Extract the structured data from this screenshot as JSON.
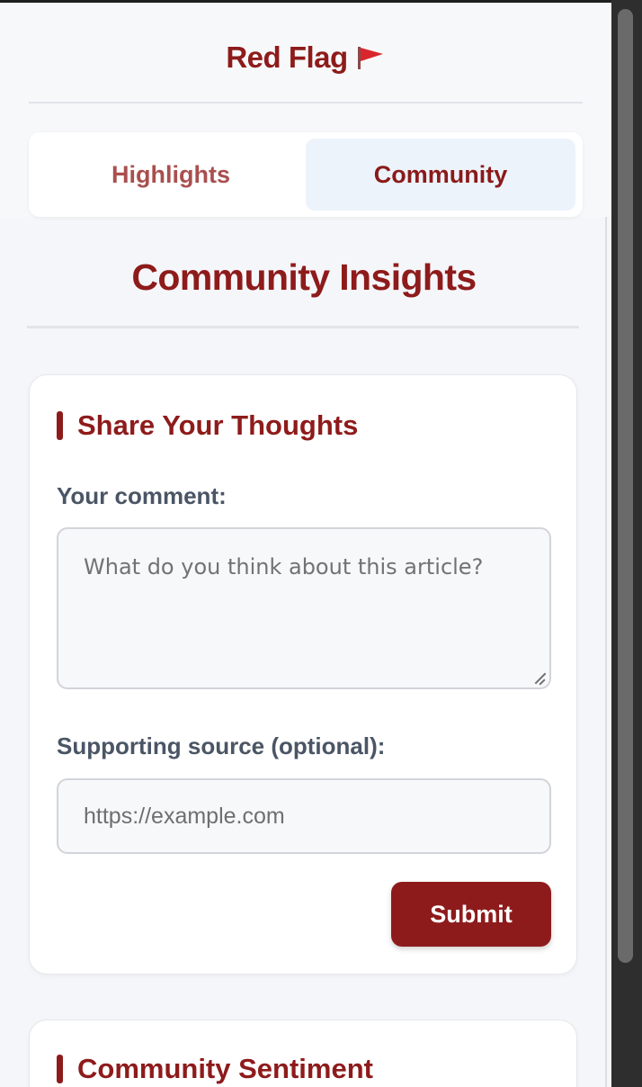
{
  "header": {
    "app_title": "Red Flag",
    "flag_icon": "red-flag-icon"
  },
  "tabs": [
    {
      "label": "Highlights",
      "active": false
    },
    {
      "label": "Community",
      "active": true
    }
  ],
  "main": {
    "section_title": "Community Insights"
  },
  "share_card": {
    "heading": "Share Your Thoughts",
    "comment_label": "Your comment:",
    "comment_value": "",
    "comment_placeholder": "What do you think about this article?",
    "source_label": "Supporting source (optional):",
    "source_value": "",
    "source_placeholder": "https://example.com",
    "submit_label": "Submit"
  },
  "sentiment_card": {
    "heading": "Community Sentiment"
  },
  "colors": {
    "brand": "#8e1b1b",
    "active_tab_bg": "#edf3fb",
    "page_bg": "#f5f6f9"
  }
}
